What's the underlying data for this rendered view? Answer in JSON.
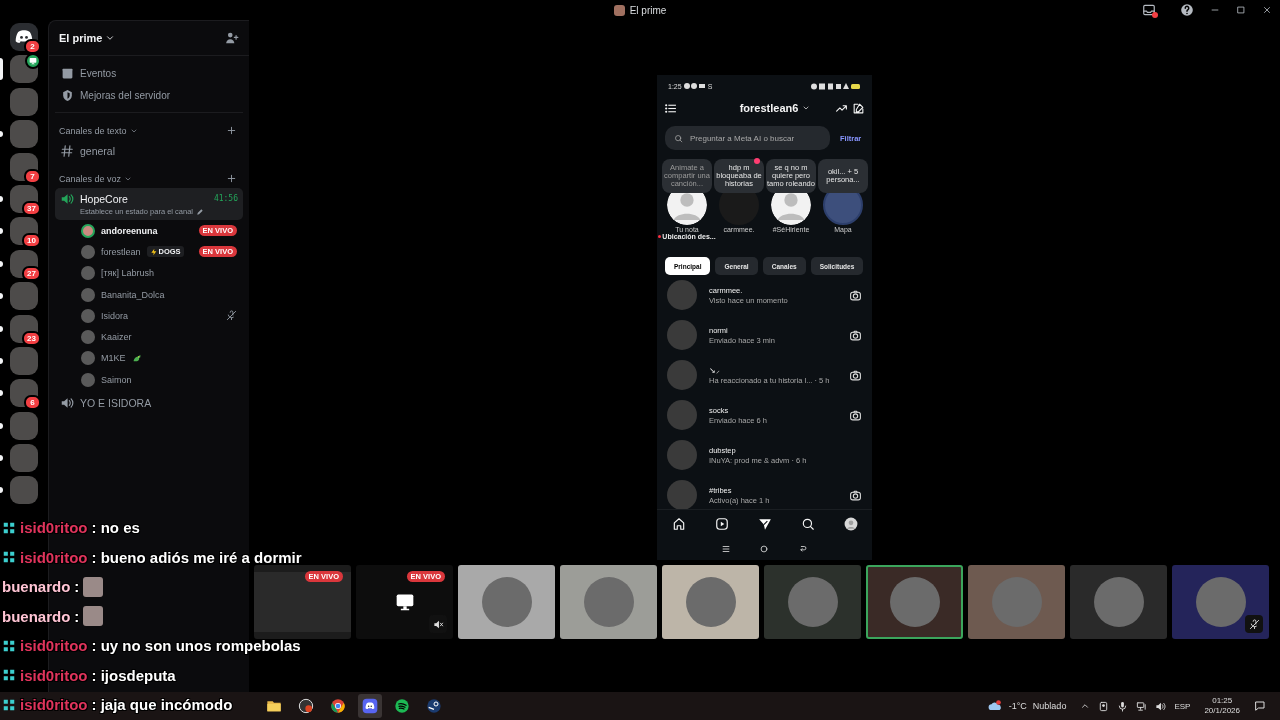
{
  "window": {
    "title": "El prime"
  },
  "servers": [
    {
      "kind": "home",
      "badge": "2",
      "selected": false,
      "unread": false,
      "live": false
    },
    {
      "kind": "avatar",
      "selected": true,
      "unread": false,
      "live": true
    },
    {
      "kind": "avatar",
      "selected": false,
      "unread": false,
      "live": false
    },
    {
      "kind": "avatar",
      "selected": false,
      "unread": true,
      "live": false
    },
    {
      "kind": "avatar",
      "badge": "7",
      "selected": false,
      "unread": false,
      "live": false
    },
    {
      "kind": "avatar",
      "badge": "37",
      "selected": false,
      "unread": true,
      "live": false
    },
    {
      "kind": "avatar",
      "badge": "10",
      "selected": false,
      "unread": true,
      "live": false
    },
    {
      "kind": "avatar",
      "badge": "27",
      "selected": false,
      "unread": true,
      "live": false
    },
    {
      "kind": "avatar",
      "selected": false,
      "unread": true,
      "live": false
    },
    {
      "kind": "avatar",
      "badge": "23",
      "selected": false,
      "unread": true,
      "live": false
    },
    {
      "kind": "avatar",
      "selected": false,
      "unread": true,
      "live": false
    },
    {
      "kind": "avatar",
      "badge": "6",
      "selected": false,
      "unread": true,
      "live": false
    },
    {
      "kind": "avatar",
      "selected": false,
      "unread": true,
      "live": false
    },
    {
      "kind": "avatar",
      "selected": false,
      "unread": true,
      "live": false
    },
    {
      "kind": "avatar",
      "selected": false,
      "unread": true,
      "live": false
    }
  ],
  "sidebar": {
    "server_name": "El prime",
    "menu_items": [
      {
        "kind": "events",
        "label": "Eventos"
      },
      {
        "kind": "boosts",
        "label": "Mejoras del servidor"
      }
    ],
    "categories": [
      {
        "label": "Canales de texto",
        "channels": [
          {
            "kind": "text",
            "name": "general",
            "selected": false
          }
        ]
      },
      {
        "label": "Canales de voz",
        "channels": [
          {
            "kind": "voice",
            "name": "HopeCore",
            "selected": true,
            "timer": "41:56",
            "status": "Establece un estado para el canal",
            "members": [
              {
                "name": "andoreenuna",
                "speaking": true,
                "muted": false,
                "emoji": false,
                "badge": "EN VIVO"
              },
              {
                "name": "forestlean",
                "speaking": false,
                "muted": false,
                "emoji": false,
                "tag": "DOGS",
                "badge": "EN VIVO"
              },
              {
                "name": "[тяк] Labrush",
                "speaking": false,
                "muted": false,
                "emoji": false
              },
              {
                "name": "Bananita_Dolca",
                "speaking": false,
                "muted": false,
                "emoji": false
              },
              {
                "name": "Isidora",
                "speaking": false,
                "muted": true,
                "emoji": false
              },
              {
                "name": "Kaaizer",
                "speaking": false,
                "muted": false,
                "emoji": false
              },
              {
                "name": "M1KE",
                "speaking": false,
                "muted": false,
                "emoji": true
              },
              {
                "name": "Saimon",
                "speaking": false,
                "muted": false,
                "emoji": false
              }
            ]
          },
          {
            "kind": "voice",
            "name": "YO E ISIDORA",
            "selected": false
          }
        ]
      }
    ]
  },
  "phone": {
    "status_time": "1:25",
    "status_letter": "S",
    "title": "forestlean6",
    "search": {
      "placeholder": "Preguntar a Meta AI o buscar"
    },
    "filter": "Filtrar",
    "notes": [
      {
        "kind": "prompt",
        "bubble": "Animate a compartir una canción...",
        "label": "Tu nota",
        "sublabel": "Ubicación des...",
        "heart": false
      },
      {
        "kind": "note",
        "bubble": "hdp m bloqueaba de historias",
        "label": "carmmee.",
        "heart": true
      },
      {
        "kind": "note",
        "bubble": "se q no m quiere pero tamo roleando",
        "label": "#SéHiriente",
        "heart": false
      },
      {
        "kind": "map",
        "bubble": "okil... + 5 persona...",
        "label": "Mapa",
        "heart": false
      }
    ],
    "tabs": [
      {
        "label": "Principal",
        "selected": true
      },
      {
        "label": "General",
        "selected": false
      },
      {
        "label": "Canales",
        "selected": false
      },
      {
        "label": "Solicitudes",
        "selected": false
      }
    ],
    "threads": [
      {
        "name": "carmmee.",
        "preview": "Visto hace un momento",
        "camera": true
      },
      {
        "name": "normi",
        "preview": "Enviado hace 3 min",
        "camera": true
      },
      {
        "name": "↘⸝",
        "preview": "Ha reaccionado a tu historia l... · 5 h",
        "camera": true
      },
      {
        "name": "socks",
        "preview": "Enviado hace 6 h",
        "camera": true
      },
      {
        "name": "dubstep",
        "preview": "INuYA: prod me & advm · 6 h",
        "camera": false
      },
      {
        "name": "#tribes",
        "preview": "Activo(a) hace 1 h",
        "camera": true
      }
    ],
    "nav": [
      {
        "kind": "home",
        "selected": false
      },
      {
        "kind": "reels",
        "selected": false
      },
      {
        "kind": "direct",
        "selected": true
      },
      {
        "kind": "search",
        "selected": false
      },
      {
        "kind": "profile",
        "selected": false
      }
    ]
  },
  "tiles": [
    {
      "kind": "stream",
      "badge": "EN VIVO",
      "color": "#1c1c1c",
      "muted": false,
      "speaking": false
    },
    {
      "kind": "stream",
      "badge": "EN VIVO",
      "color": "#0d0d0d",
      "muted": true,
      "speaking": false
    },
    {
      "kind": "avatar",
      "color": "#a9a9a9",
      "muted": false,
      "speaking": false
    },
    {
      "kind": "avatar",
      "color": "#9c9d98",
      "muted": false,
      "speaking": false
    },
    {
      "kind": "avatar",
      "color": "#bdb5a8",
      "muted": false,
      "speaking": false
    },
    {
      "kind": "avatar",
      "color": "#2c312c",
      "muted": false,
      "speaking": false
    },
    {
      "kind": "avatar",
      "color": "#3a2a26",
      "muted": false,
      "speaking": true
    },
    {
      "kind": "avatar",
      "color": "#6e5a50",
      "muted": false,
      "speaking": false
    },
    {
      "kind": "avatar",
      "color": "#2a2a2a",
      "muted": false,
      "speaking": false
    },
    {
      "kind": "avatar",
      "color": "#24245a",
      "muted": true,
      "speaking": false
    }
  ],
  "chat": [
    {
      "user": "isid0ritoo",
      "color": "#e0345c",
      "kind": "text",
      "badge": true,
      "text": ": no es"
    },
    {
      "user": "isid0ritoo",
      "color": "#e0345c",
      "kind": "text",
      "badge": true,
      "text": ": bueno adiós me iré a dormir"
    },
    {
      "user": "buenardo",
      "color": "#ffc4d4",
      "kind": "emote",
      "badge": false,
      "text": ":"
    },
    {
      "user": "buenardo",
      "color": "#ffc4d4",
      "kind": "emote",
      "badge": false,
      "text": ":"
    },
    {
      "user": "isid0ritoo",
      "color": "#e0345c",
      "kind": "text",
      "badge": true,
      "text": ": uy no son unos rompebolas"
    },
    {
      "user": "isid0ritoo",
      "color": "#e0345c",
      "kind": "text",
      "badge": true,
      "text": ": ijosdeputa"
    },
    {
      "user": "isid0ritoo",
      "color": "#e0345c",
      "kind": "text",
      "badge": true,
      "text": ": jaja que incómodo"
    }
  ],
  "taskbar": {
    "apps": [
      {
        "kind": "folder",
        "selected": false
      },
      {
        "kind": "recorder",
        "selected": false
      },
      {
        "kind": "browser",
        "selected": false
      },
      {
        "kind": "chat",
        "selected": true
      },
      {
        "kind": "music",
        "selected": false
      },
      {
        "kind": "games",
        "selected": false
      }
    ],
    "temperature": "-1°C",
    "weather": "Nublado",
    "language": "ESP",
    "time": "01:25",
    "date": "20/1/2026"
  }
}
